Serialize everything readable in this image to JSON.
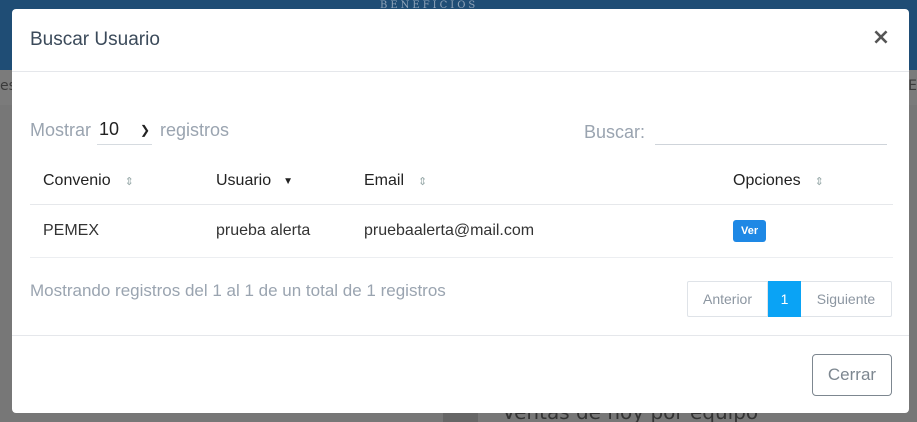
{
  "background": {
    "logo_text": "BENEFICIOS",
    "band_left": "es",
    "band_right": "E",
    "bottom_text": "Ventas de hoy por equipo"
  },
  "modal": {
    "title": "Buscar Usuario",
    "close_icon": "×"
  },
  "length": {
    "prefix": "Mostrar",
    "value": "10",
    "suffix": "registros"
  },
  "search": {
    "label": "Buscar:",
    "value": "",
    "placeholder": ""
  },
  "table": {
    "columns": [
      {
        "label": "Convenio",
        "sort": "both"
      },
      {
        "label": "Usuario",
        "sort": "desc"
      },
      {
        "label": "Email",
        "sort": "both"
      },
      {
        "label": "Opciones",
        "sort": "both"
      }
    ],
    "rows": [
      {
        "convenio": "PEMEX",
        "usuario": "prueba alerta",
        "email": "pruebaalerta@mail.com",
        "action": "Ver"
      }
    ]
  },
  "info": "Mostrando registros del 1 al 1 de un total de 1 registros",
  "pagination": {
    "prev": "Anterior",
    "current": "1",
    "next": "Siguiente"
  },
  "footer": {
    "close_label": "Cerrar"
  },
  "colors": {
    "accent": "#0aa3f5",
    "button_primary": "#1e88e5",
    "muted_text": "#9aa4b0"
  }
}
